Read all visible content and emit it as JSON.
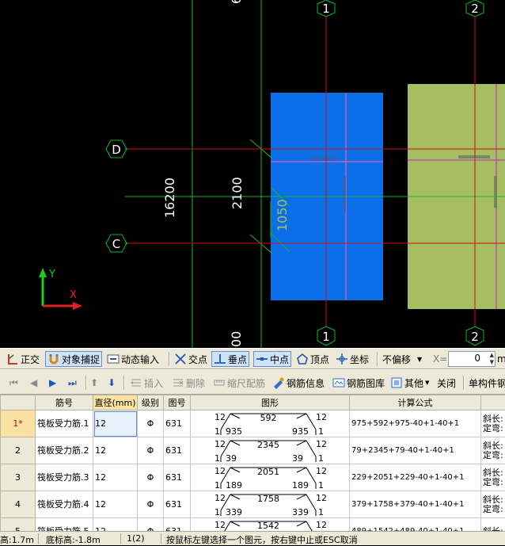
{
  "canvas": {
    "axis_labels": {
      "top_1": "1",
      "top_2": "2",
      "bottom_1": "1",
      "bottom_2": "2",
      "row_d": "D",
      "row_c": "C",
      "cut_top": "6",
      "cut_bottom": "00"
    },
    "dimensions": {
      "total": "16200",
      "span": "2100",
      "half": "1050"
    },
    "ucs": {
      "x": "X",
      "y": "Y"
    },
    "colors": {
      "slab_blue": "#0a6fe8",
      "slab_green": "#a6bd62",
      "axis_red": "#d01010",
      "grid_green": "#0fb82f"
    }
  },
  "snapbar": {
    "ortho": "正交",
    "osnap": "对象捕捉",
    "dyninput": "动态输入",
    "intersection": "交点",
    "perpendicular": "垂点",
    "midpoint": "中点",
    "vertex": "顶点",
    "coordinate": "坐标",
    "offset_mode": "不偏移",
    "x_label": "X=",
    "x_value": "0",
    "x_unit": "m"
  },
  "gridbar": {
    "insert": "插入",
    "delete": "删除",
    "scale_rebar": "缩尺配筋",
    "rebar_info": "钢筋信息",
    "rebar_library": "钢筋图库",
    "other": "其他",
    "close": "关闭",
    "single_member": "单构件钢"
  },
  "table": {
    "headers": {
      "bar_no": "筋号",
      "diameter": "直径(mm)",
      "grade": "级别",
      "shape_no": "图号",
      "shape": "图形",
      "formula": "计算公式"
    },
    "rows": [
      {
        "idx": "1*",
        "name": "筏板受力筋.1",
        "dia": "12",
        "grade": "Φ",
        "fig": "631",
        "top_len": "592",
        "bot_left": "935",
        "bot_right": "935",
        "hook_l": "12",
        "hook_r": "12",
        "end_l": "1",
        "end_r": "1",
        "formula": "975+592+975-40+1-40+1",
        "note1": "斜长:",
        "note2": "定弯:"
      },
      {
        "idx": "2",
        "name": "筏板受力筋.2",
        "dia": "12",
        "grade": "Φ",
        "fig": "631",
        "top_len": "2345",
        "bot_left": "39",
        "bot_right": "39",
        "hook_l": "12",
        "hook_r": "12",
        "end_l": "1",
        "end_r": "1",
        "formula": "79+2345+79-40+1-40+1",
        "note1": "斜长:",
        "note2": "定弯:"
      },
      {
        "idx": "3",
        "name": "筏板受力筋.3",
        "dia": "12",
        "grade": "Φ",
        "fig": "631",
        "top_len": "2051",
        "bot_left": "189",
        "bot_right": "189",
        "hook_l": "12",
        "hook_r": "12",
        "end_l": "1",
        "end_r": "1",
        "formula": "229+2051+229-40+1-40+1",
        "note1": "斜长:",
        "note2": "定弯:"
      },
      {
        "idx": "4",
        "name": "筏板受力筋.4",
        "dia": "12",
        "grade": "Φ",
        "fig": "631",
        "top_len": "1758",
        "bot_left": "339",
        "bot_right": "339",
        "hook_l": "12",
        "hook_r": "12",
        "end_l": "1",
        "end_r": "1",
        "formula": "379+1758+379-40+1-40+1",
        "note1": "斜长:",
        "note2": "定弯:"
      },
      {
        "idx": "5",
        "name": "筏板受力筋.5",
        "dia": "12",
        "grade": "Φ",
        "fig": "631",
        "top_len": "1542",
        "bot_left": "",
        "bot_right": "",
        "hook_l": "12",
        "hook_r": "12",
        "end_l": "",
        "end_r": "",
        "formula": "489+1542+489-40+1-40+1",
        "note1": "斜长:",
        "note2": ""
      }
    ]
  },
  "status": {
    "floor_height": "高:1.7m",
    "bottom_elev": "底标高:-1.8m",
    "selection": "1(2)",
    "message": "按鼠标左键选择一个图元，按右键中止或ESC取消"
  }
}
